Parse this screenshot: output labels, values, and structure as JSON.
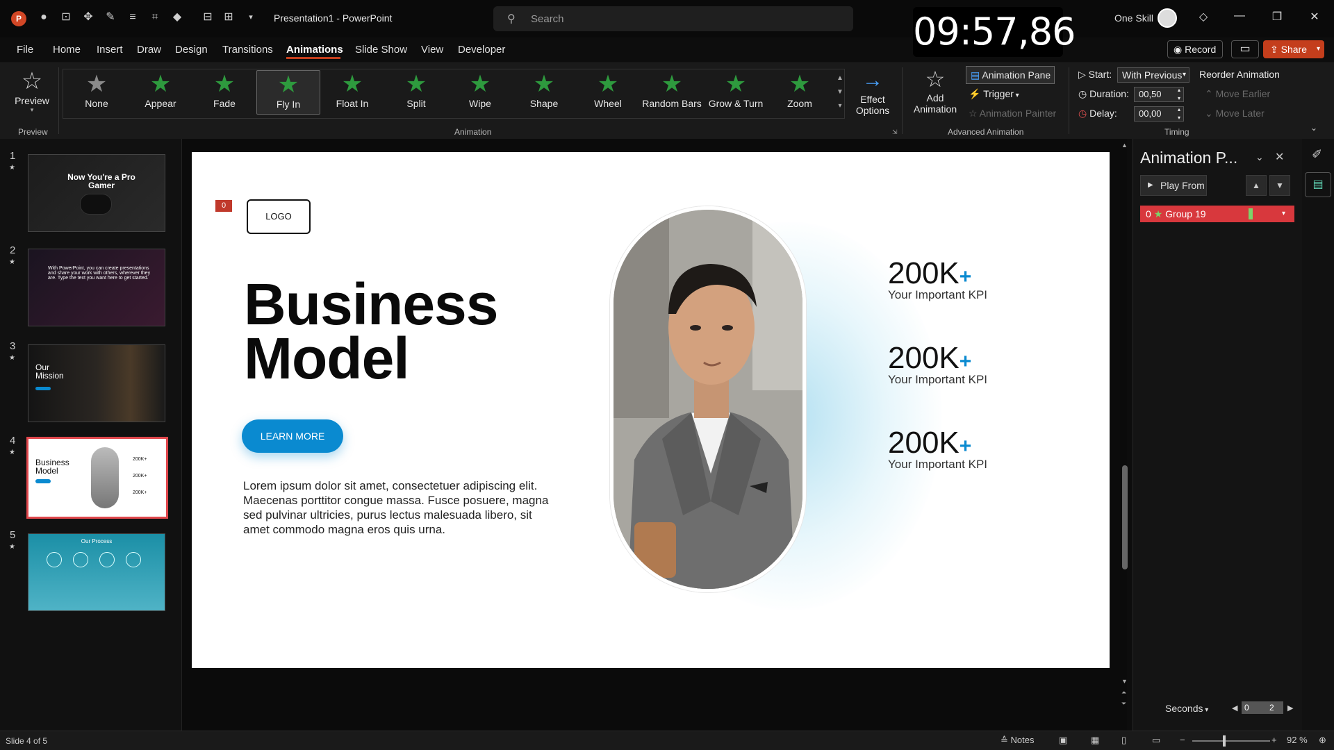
{
  "app": {
    "title": "Presentation1  -  PowerPoint",
    "logo": "P"
  },
  "search": {
    "placeholder": "Search"
  },
  "timer": "09:57,86",
  "user": {
    "name": "One Skill"
  },
  "menu": [
    "File",
    "Home",
    "Insert",
    "Draw",
    "Design",
    "Transitions",
    "Animations",
    "Slide Show",
    "View",
    "Developer"
  ],
  "menu_active": "Animations",
  "actions": {
    "record": "Record",
    "share": "Share"
  },
  "ribbon": {
    "preview": "Preview",
    "preview_group": "Preview",
    "animations": [
      "None",
      "Appear",
      "Fade",
      "Fly In",
      "Float In",
      "Split",
      "Wipe",
      "Shape",
      "Wheel",
      "Random Bars",
      "Grow & Turn",
      "Zoom"
    ],
    "selected_animation": "Fly In",
    "animation_group": "Animation",
    "effect_options": "Effect\nOptions",
    "effect_options_l1": "Effect",
    "effect_options_l2": "Options",
    "add_animation_l1": "Add",
    "add_animation_l2": "Animation",
    "animation_pane": "Animation Pane",
    "trigger": "Trigger",
    "animation_painter": "Animation Painter",
    "advanced_group": "Advanced Animation",
    "start_label": "Start:",
    "start_value": "With Previous",
    "duration_label": "Duration:",
    "duration_value": "00,50",
    "delay_label": "Delay:",
    "delay_value": "00,00",
    "reorder": "Reorder Animation",
    "move_earlier": "Move Earlier",
    "move_later": "Move Later",
    "timing_group": "Timing"
  },
  "thumbnails": [
    {
      "num": "1",
      "title": "Now You're a Pro Gamer"
    },
    {
      "num": "2",
      "title": "With PowerPoint, you can create presentations and share your work with others, wherever they are. Type the text you want here to get started."
    },
    {
      "num": "3",
      "title": "Our Mission"
    },
    {
      "num": "4",
      "title": "Business Model",
      "kpi": "200K+"
    },
    {
      "num": "5",
      "title": "Our Process"
    }
  ],
  "slide": {
    "tag": "0",
    "logo": "LOGO",
    "title_l1": "Business",
    "title_l2": "Model",
    "button": "LEARN MORE",
    "body": "Lorem ipsum dolor sit amet, consectetuer adipiscing elit. Maecenas porttitor congue massa. Fusce posuere, magna sed pulvinar ultricies, purus lectus malesuada libero, sit amet commodo magna eros quis urna.",
    "kpis": [
      {
        "value": "200K",
        "plus": "+",
        "label": "Your Important KPI"
      },
      {
        "value": "200K",
        "plus": "+",
        "label": "Your Important KPI"
      },
      {
        "value": "200K",
        "plus": "+",
        "label": "Your Important KPI"
      }
    ]
  },
  "pane": {
    "title": "Animation P...",
    "play_from": "Play From",
    "item_index": "0",
    "item_name": "Group 19",
    "seconds": "Seconds",
    "timeline_start": "0",
    "timeline_end": "2"
  },
  "status": {
    "slide_info": "Slide 4 of 5",
    "notes": "Notes",
    "zoom": "92 %"
  },
  "colors": {
    "accent": "#c43e1c",
    "anim_green": "#2e9a3e",
    "slide_blue": "#0a8ad0",
    "selection": "#d8383d"
  }
}
